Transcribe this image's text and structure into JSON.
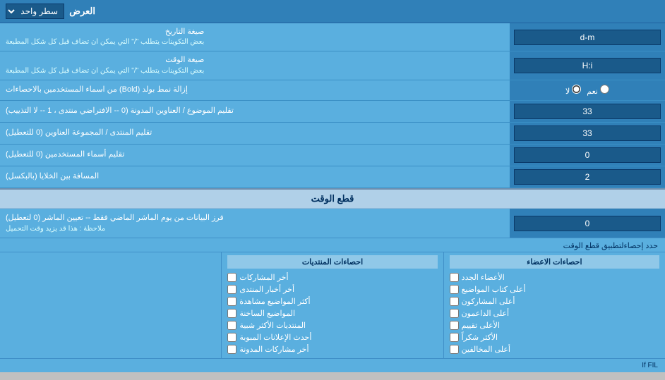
{
  "header": {
    "label": "العرض",
    "dropdown_label": "سطر واحد"
  },
  "rows": [
    {
      "id": "date_format",
      "label": "صيغة التاريخ",
      "sublabel": "بعض التكوينات يتطلب \"/\" التي يمكن ان تضاف قبل كل شكل المطبعة",
      "input_value": "d-m",
      "type": "text"
    },
    {
      "id": "time_format",
      "label": "صيغة الوقت",
      "sublabel": "بعض التكوينات يتطلب \"/\" التي يمكن ان تضاف قبل كل شكل المطبعة",
      "input_value": "H:i",
      "type": "text"
    },
    {
      "id": "bold_stats",
      "label": "إزالة نمط بولد (Bold) من اسماء المستخدمين بالاحصاءات",
      "type": "radio",
      "options": [
        {
          "value": "yes",
          "label": "نعم"
        },
        {
          "value": "no",
          "label": "لا",
          "selected": true
        }
      ]
    },
    {
      "id": "topic_titles",
      "label": "تقليم الموضوع / العناوين المدونة (0 -- الافتراضي منتدى ، 1 -- لا التذييب)",
      "input_value": "33",
      "type": "text"
    },
    {
      "id": "forum_titles",
      "label": "تقليم المنتدى / المجموعة العناوين (0 للتعطيل)",
      "input_value": "33",
      "type": "text"
    },
    {
      "id": "user_names",
      "label": "تقليم أسماء المستخدمين (0 للتعطيل)",
      "input_value": "0",
      "type": "text"
    },
    {
      "id": "cell_distance",
      "label": "المسافة بين الخلايا (بالبكسل)",
      "input_value": "2",
      "type": "text"
    }
  ],
  "time_section": {
    "header": "قطع الوقت",
    "row": {
      "label": "فرز البيانات من يوم الماشر الماضي فقط -- تعيين الماشر (0 لتعطيل)",
      "note": "ملاحظة : هذا قد يزيد وقت التحميل",
      "input_value": "0"
    },
    "limit_label": "حدد إحصاءلتطبيق قطع الوقت"
  },
  "checkbox_cols": [
    {
      "header": "",
      "items": []
    }
  ],
  "stats_cols": [
    {
      "header": "احصاءات المنتديات",
      "items": [
        "أخر المشاركات",
        "أخر أخبار المنتدى",
        "أكثر المواضيع مشاهدة",
        "المواضيع الساخنة",
        "المنتديات الأكثر شبية",
        "أحدث الإعلانات المبوبة",
        "أخر مشاركات المدونة"
      ]
    },
    {
      "header": "احصاءات الاعضاء",
      "items": [
        "الأعضاء الجدد",
        "أعلى كتاب المواضيع",
        "أعلى الداعمون",
        "الأعلى تقييم",
        "الأكثر شكراً",
        "أعلى المخالفين"
      ]
    }
  ],
  "colors": {
    "bg_dark": "#3080b8",
    "bg_medium": "#5aafdf",
    "bg_light": "#b0d0e8",
    "text_dark": "#003060",
    "text_light": "#ffffff",
    "input_bg": "#1a5a8a"
  }
}
